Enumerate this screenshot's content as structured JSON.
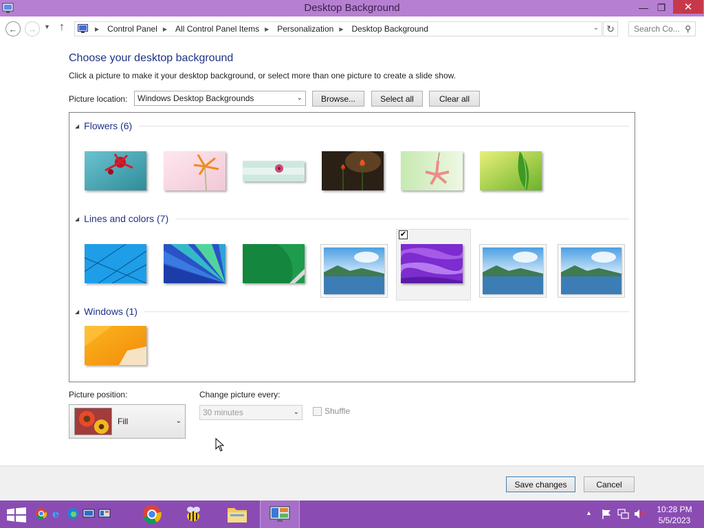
{
  "window": {
    "title": "Desktop Background",
    "minimize_glyph": "—",
    "maximize_glyph": "❐",
    "close_glyph": "✕"
  },
  "nav": {
    "back_glyph": "←",
    "forward_glyph": "→",
    "recent_glyph": "▼",
    "up_glyph": "↑",
    "breadcrumbs": [
      "Control Panel",
      "All Control Panel Items",
      "Personalization",
      "Desktop Background"
    ],
    "separator_glyph": "▶",
    "dropdown_glyph": "⌄",
    "refresh_glyph": "↻",
    "search_placeholder": "Search Co...",
    "search_glyph": "⚲"
  },
  "content": {
    "heading": "Choose your desktop background",
    "instruction": "Click a picture to make it your desktop background, or select more than one picture to create a slide show.",
    "picture_location_label": "Picture location:",
    "picture_location_value": "Windows Desktop Backgrounds",
    "browse_label": "Browse...",
    "select_all_label": "Select all",
    "clear_all_label": "Clear all"
  },
  "groups": [
    {
      "title": "Flowers (6)"
    },
    {
      "title": "Lines and colors (7)"
    },
    {
      "title": "Windows (1)"
    }
  ],
  "pictures": {
    "flowers": [
      "red-flower-teal",
      "orange-flower-pink",
      "pink-flower-mint",
      "red-tulips-dark",
      "pink-lily-green",
      "green-leaf"
    ],
    "lines": [
      "blue-lines",
      "blue-green-fan",
      "green-ribbon",
      "lake-landscape",
      "purple-waves",
      "lake-landscape",
      "lake-landscape"
    ],
    "windows": [
      "orange-windows"
    ],
    "selected": "purple-waves",
    "selected_check_glyph": "✔"
  },
  "bottom": {
    "picture_position_label": "Picture position:",
    "picture_position_value": "Fill",
    "change_picture_label": "Change picture every:",
    "change_picture_value": "30 minutes",
    "shuffle_label": "Shuffle",
    "caret_glyph": "⌄"
  },
  "footer": {
    "save_label": "Save changes",
    "cancel_label": "Cancel"
  },
  "taskbar": {
    "time": "10:28 PM",
    "date": "5/5/2023",
    "tray_up_glyph": "▲"
  },
  "colors": {
    "titlebar": "#b77fd1",
    "taskbar": "#8a4cb3",
    "heading": "#1e3287",
    "close_button": "#c7394a"
  }
}
